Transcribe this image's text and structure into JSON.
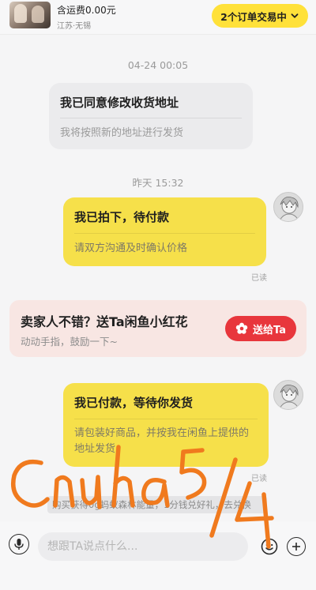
{
  "header": {
    "price": "含运费0.00元",
    "location": "江苏·无锡",
    "orders_button": "2个订单交易中"
  },
  "messages": [
    {
      "timestamp": "04-24 00:05"
    },
    {
      "title": "我已同意修改收货地址",
      "subtitle": "我将按照新的地址进行发货"
    },
    {
      "timestamp": "昨天 15:32"
    },
    {
      "title": "我已拍下，待付款",
      "subtitle": "请双方沟通及时确认价格",
      "status": "已读"
    },
    {
      "title": "我已付款，等待你发货",
      "subtitle": "请包装好商品，并按我在闲鱼上提供的地址发货",
      "status": "已读"
    }
  ],
  "promo": {
    "title": "卖家人不错？送Ta闲鱼小红花",
    "subtitle": "动动手指，鼓励一下~",
    "button": "送给Ta"
  },
  "hint_bar": "购买获得0g蚂蚁森林能量，1分钱兑好礼，去兑换",
  "input": {
    "placeholder": "想跟TA说点什么..."
  },
  "annotation": {
    "handwriting": "Cnuha5/4"
  },
  "colors": {
    "accent_yellow": "#ffe13a",
    "bubble_yellow": "#f6e04a",
    "gift_red": "#e8363c",
    "handwriting": "#f07a1e"
  },
  "icons": [
    "chevron-down-icon",
    "avatar",
    "flower-icon",
    "microphone-icon",
    "emoji-icon",
    "plus-icon"
  ]
}
